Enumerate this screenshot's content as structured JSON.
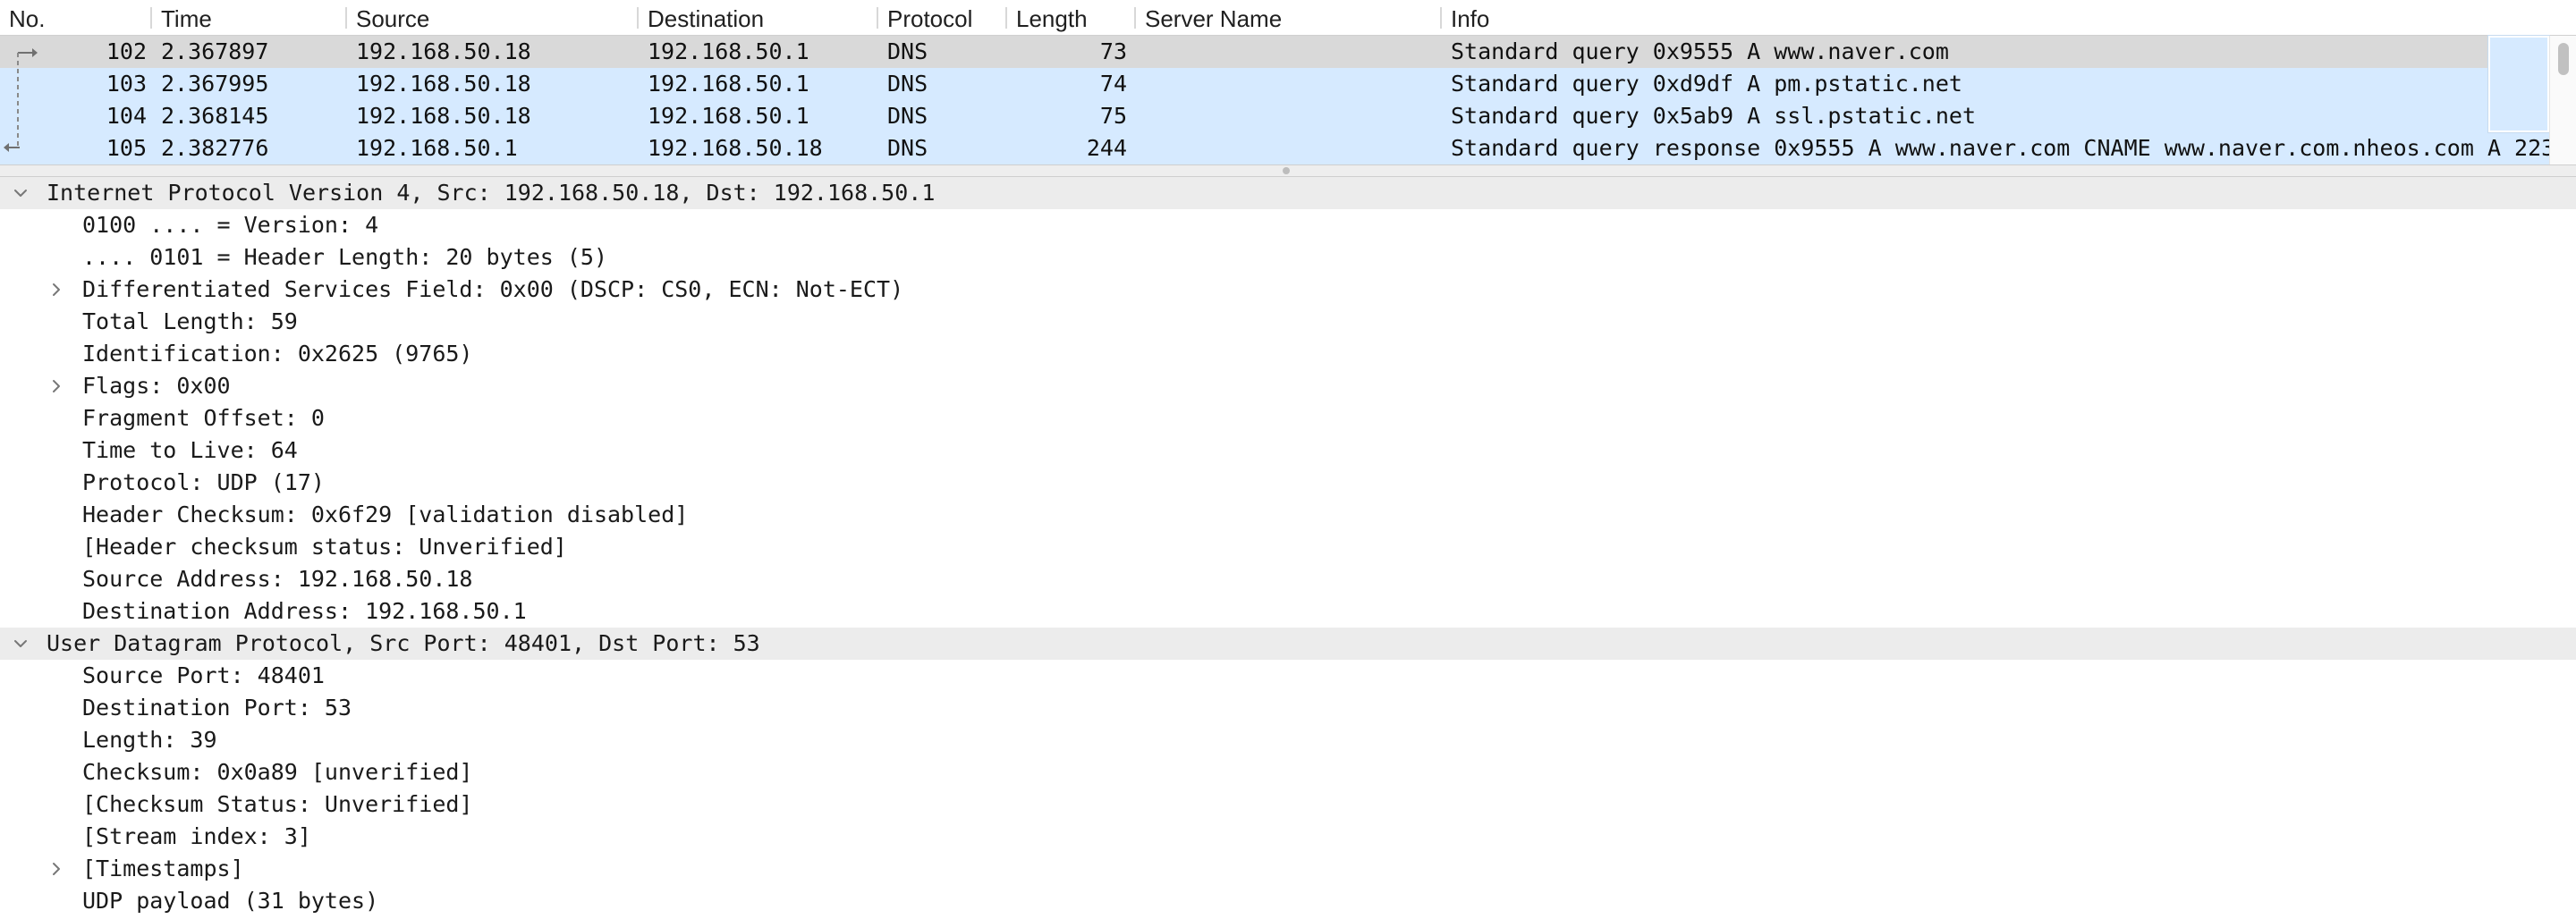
{
  "packet_list": {
    "columns": [
      "No.",
      "Time",
      "Source",
      "Destination",
      "Protocol",
      "Length",
      "Server Name",
      "Info"
    ],
    "rows": [
      {
        "no": "102",
        "time": "2.367897",
        "source": "192.168.50.18",
        "destination": "192.168.50.1",
        "protocol": "DNS",
        "length": "73",
        "server_name": "",
        "info": "Standard query 0x9555 A www.naver.com",
        "selected": true
      },
      {
        "no": "103",
        "time": "2.367995",
        "source": "192.168.50.18",
        "destination": "192.168.50.1",
        "protocol": "DNS",
        "length": "74",
        "server_name": "",
        "info": "Standard query 0xd9df A pm.pstatic.net",
        "selected": false
      },
      {
        "no": "104",
        "time": "2.368145",
        "source": "192.168.50.18",
        "destination": "192.168.50.1",
        "protocol": "DNS",
        "length": "75",
        "server_name": "",
        "info": "Standard query 0x5ab9 A ssl.pstatic.net",
        "selected": false
      },
      {
        "no": "105",
        "time": "2.382776",
        "source": "192.168.50.1",
        "destination": "192.168.50.18",
        "protocol": "DNS",
        "length": "244",
        "server_name": "",
        "info": "Standard query response 0x9555 A www.naver.com CNAME www.naver.com.nheos.com A 223",
        "selected": false
      }
    ],
    "row_colors": {
      "normal": "#d6eaff",
      "selected": "#d9d9d9"
    }
  },
  "details": {
    "rows": [
      {
        "kind": "section",
        "toggle": "expanded",
        "text": "Internet Protocol Version 4, Src: 192.168.50.18, Dst: 192.168.50.1"
      },
      {
        "kind": "field",
        "toggle": "none",
        "text": "0100 .... = Version: 4"
      },
      {
        "kind": "field",
        "toggle": "none",
        "text": ".... 0101 = Header Length: 20 bytes (5)"
      },
      {
        "kind": "field",
        "toggle": "collapsed",
        "text": "Differentiated Services Field: 0x00 (DSCP: CS0, ECN: Not-ECT)"
      },
      {
        "kind": "field",
        "toggle": "none",
        "text": "Total Length: 59"
      },
      {
        "kind": "field",
        "toggle": "none",
        "text": "Identification: 0x2625 (9765)"
      },
      {
        "kind": "field",
        "toggle": "collapsed",
        "text": "Flags: 0x00"
      },
      {
        "kind": "field",
        "toggle": "none",
        "text": "Fragment Offset: 0"
      },
      {
        "kind": "field",
        "toggle": "none",
        "text": "Time to Live: 64"
      },
      {
        "kind": "field",
        "toggle": "none",
        "text": "Protocol: UDP (17)"
      },
      {
        "kind": "field",
        "toggle": "none",
        "text": "Header Checksum: 0x6f29 [validation disabled]"
      },
      {
        "kind": "field",
        "toggle": "none",
        "text": "[Header checksum status: Unverified]"
      },
      {
        "kind": "field",
        "toggle": "none",
        "text": "Source Address: 192.168.50.18"
      },
      {
        "kind": "field",
        "toggle": "none",
        "text": "Destination Address: 192.168.50.1"
      },
      {
        "kind": "section",
        "toggle": "expanded",
        "text": "User Datagram Protocol, Src Port: 48401, Dst Port: 53"
      },
      {
        "kind": "field",
        "toggle": "none",
        "text": "Source Port: 48401"
      },
      {
        "kind": "field",
        "toggle": "none",
        "text": "Destination Port: 53"
      },
      {
        "kind": "field",
        "toggle": "none",
        "text": "Length: 39"
      },
      {
        "kind": "field",
        "toggle": "none",
        "text": "Checksum: 0x0a89 [unverified]"
      },
      {
        "kind": "field",
        "toggle": "none",
        "text": "[Checksum Status: Unverified]"
      },
      {
        "kind": "field",
        "toggle": "none",
        "text": "[Stream index: 3]"
      },
      {
        "kind": "field",
        "toggle": "collapsed",
        "text": "[Timestamps]"
      },
      {
        "kind": "field",
        "toggle": "none",
        "text": "UDP payload (31 bytes)"
      }
    ],
    "section_background": "#ececec"
  },
  "icons": {
    "expanded": "chevron-down-icon",
    "collapsed": "chevron-right-icon",
    "related_packets": "related-packet-arrows-icon"
  }
}
